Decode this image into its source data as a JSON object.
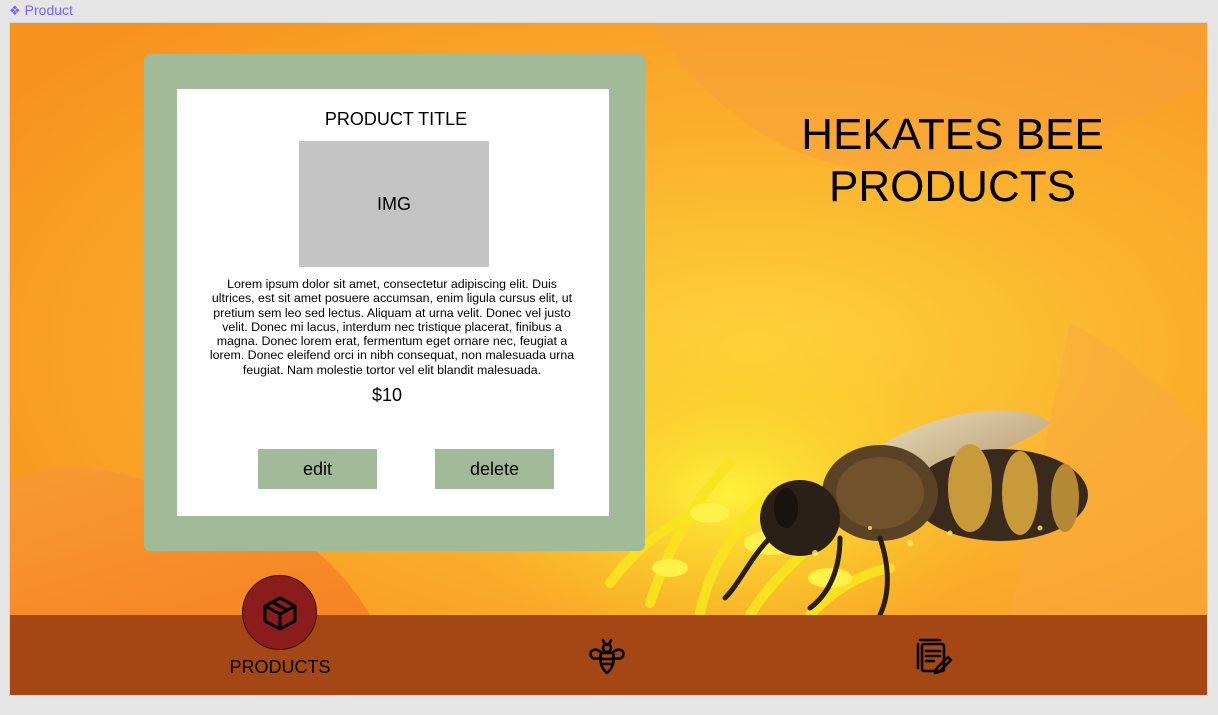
{
  "frame": {
    "label": "Product"
  },
  "card": {
    "title": "PRODUCT TITLE",
    "image_placeholder": "IMG",
    "description": "Lorem ipsum dolor sit amet, consectetur adipiscing elit. Duis ultrices, est sit amet posuere accumsan, enim ligula cursus elit, ut pretium sem leo sed lectus. Aliquam at urna velit. Donec vel justo velit. Donec mi lacus, interdum nec tristique placerat, finibus a magna. Donec lorem erat, fermentum eget ornare nec, feugiat a lorem. Donec eleifend orci in nibh consequat, non malesuada urna feugiat. Nam molestie tortor vel elit blandit malesuada.",
    "price": "$10",
    "edit_label": "edit",
    "delete_label": "delete"
  },
  "brand": {
    "line1": "HEKATES BEE",
    "line2": "PRODUCTS"
  },
  "nav": {
    "products_label": "PRODUCTS",
    "products_icon": "box-icon",
    "bee_icon": "bee-icon",
    "notes_icon": "notes-icon"
  },
  "colors": {
    "card_frame": "#a1bb98",
    "navbar": "#a54615",
    "active_nav": "#8b1c1c",
    "accent_label": "#7b61ff"
  }
}
